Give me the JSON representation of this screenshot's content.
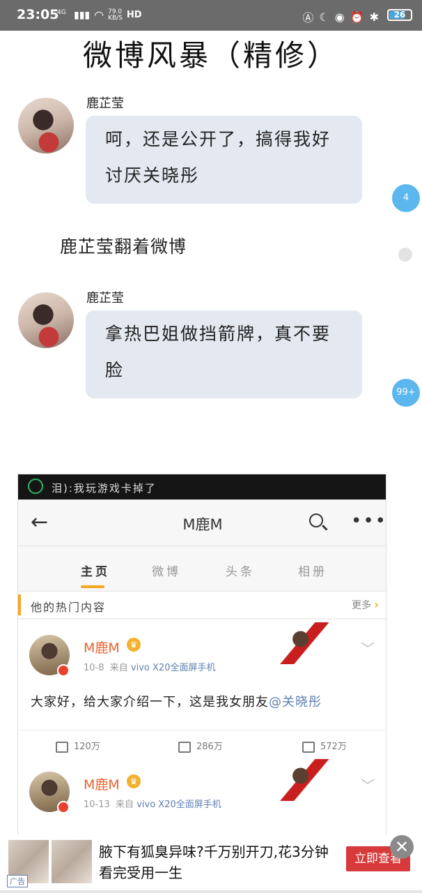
{
  "status_bar": {
    "time": "23:05",
    "network": "4G",
    "speed_value": "79.0",
    "speed_unit": "KB/S",
    "hd": "HD",
    "battery": "26"
  },
  "title": "微博风暴（精修）",
  "messages": [
    {
      "sender": "鹿芷莹",
      "text": "呵，还是公开了，搞得我好讨厌关晓彤",
      "side_count": "4"
    },
    {
      "narration": "鹿芷莹翻着微博"
    },
    {
      "sender": "鹿芷莹",
      "text": "拿热巴姐做挡箭牌，真不要脸",
      "side_count": "99+"
    }
  ],
  "screenshot": {
    "notice": "泪):我玩游戏卡掉了",
    "profile_name": "M鹿M",
    "tabs": [
      "主页",
      "微博",
      "头条",
      "相册"
    ],
    "active_tab": "主页",
    "hot_label": "他的热门内容",
    "hot_more": "更多",
    "posts": [
      {
        "name": "M鹿M",
        "date": "10-8",
        "source_prefix": "来自",
        "source": "vivo X20全面屏手机",
        "text": "大家好，给大家介绍一下，这是我女朋友",
        "mention": "@关晓彤",
        "reposts": "120万",
        "comments": "286万",
        "likes": "572万"
      },
      {
        "name": "M鹿M",
        "date": "10-13",
        "source_prefix": "来自",
        "source": "vivo X20全面屏手机"
      }
    ]
  },
  "ad": {
    "text": "腋下有狐臭异味?千万别开刀,花3分钟看完受用一生",
    "button": "立即查看",
    "tag": "广告"
  }
}
